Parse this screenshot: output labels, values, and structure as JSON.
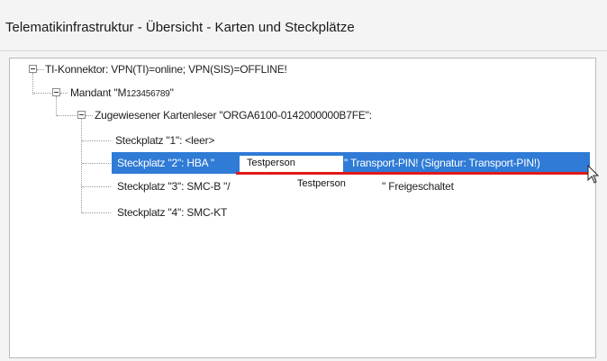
{
  "window": {
    "title": "Telematikinfrastruktur - Übersicht - Karten und Steckplätze"
  },
  "tree": {
    "connector": "TI-Konnektor: VPN(TI)=online; VPN(SIS)=OFFLINE!",
    "mandant_prefix": "Mandant \"M",
    "mandant_id": "123456789",
    "mandant_suffix": "\"",
    "reader": "Zugewiesener Kartenleser \"ORGA6100-0142000000B7FE\":",
    "slot1": "Steckplatz \"1\": <leer>",
    "slot2_prefix": "Steckplatz \"2\": HBA \"",
    "slot2_mask": "Testperson",
    "slot2_suffix": "\" Transport-PIN! (Signatur: Transport-PIN!)",
    "slot3_prefix": "Steckplatz \"3\": SMC-B \"/",
    "slot3_mask": "Testperson",
    "slot3_suffix": "\" Freigeschaltet",
    "slot4": "Steckplatz \"4\": SMC-KT"
  },
  "colors": {
    "selection": "#2f7bd6",
    "highlight_underline": "#e21a1a"
  },
  "icons": {
    "expander": "minus-box-icon",
    "cursor": "mouse-pointer-icon"
  }
}
